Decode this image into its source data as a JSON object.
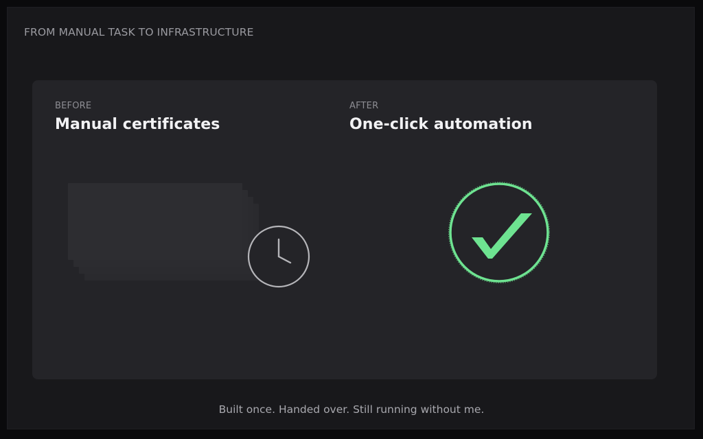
{
  "header": {
    "kicker": "FROM MANUAL TASK TO INFRASTRUCTURE"
  },
  "before": {
    "label": "BEFORE",
    "title": "Manual certificates",
    "icon": "clock-icon"
  },
  "after": {
    "label": "AFTER",
    "title": "One-click automation",
    "icon": "checkmark-icon"
  },
  "footer": {
    "tagline": "Built once. Handed over. Still running without me."
  },
  "colors": {
    "background": "#18181b",
    "panel": "#242428",
    "accent_green": "#6ee391",
    "clock_gray": "#b5b5b9"
  }
}
